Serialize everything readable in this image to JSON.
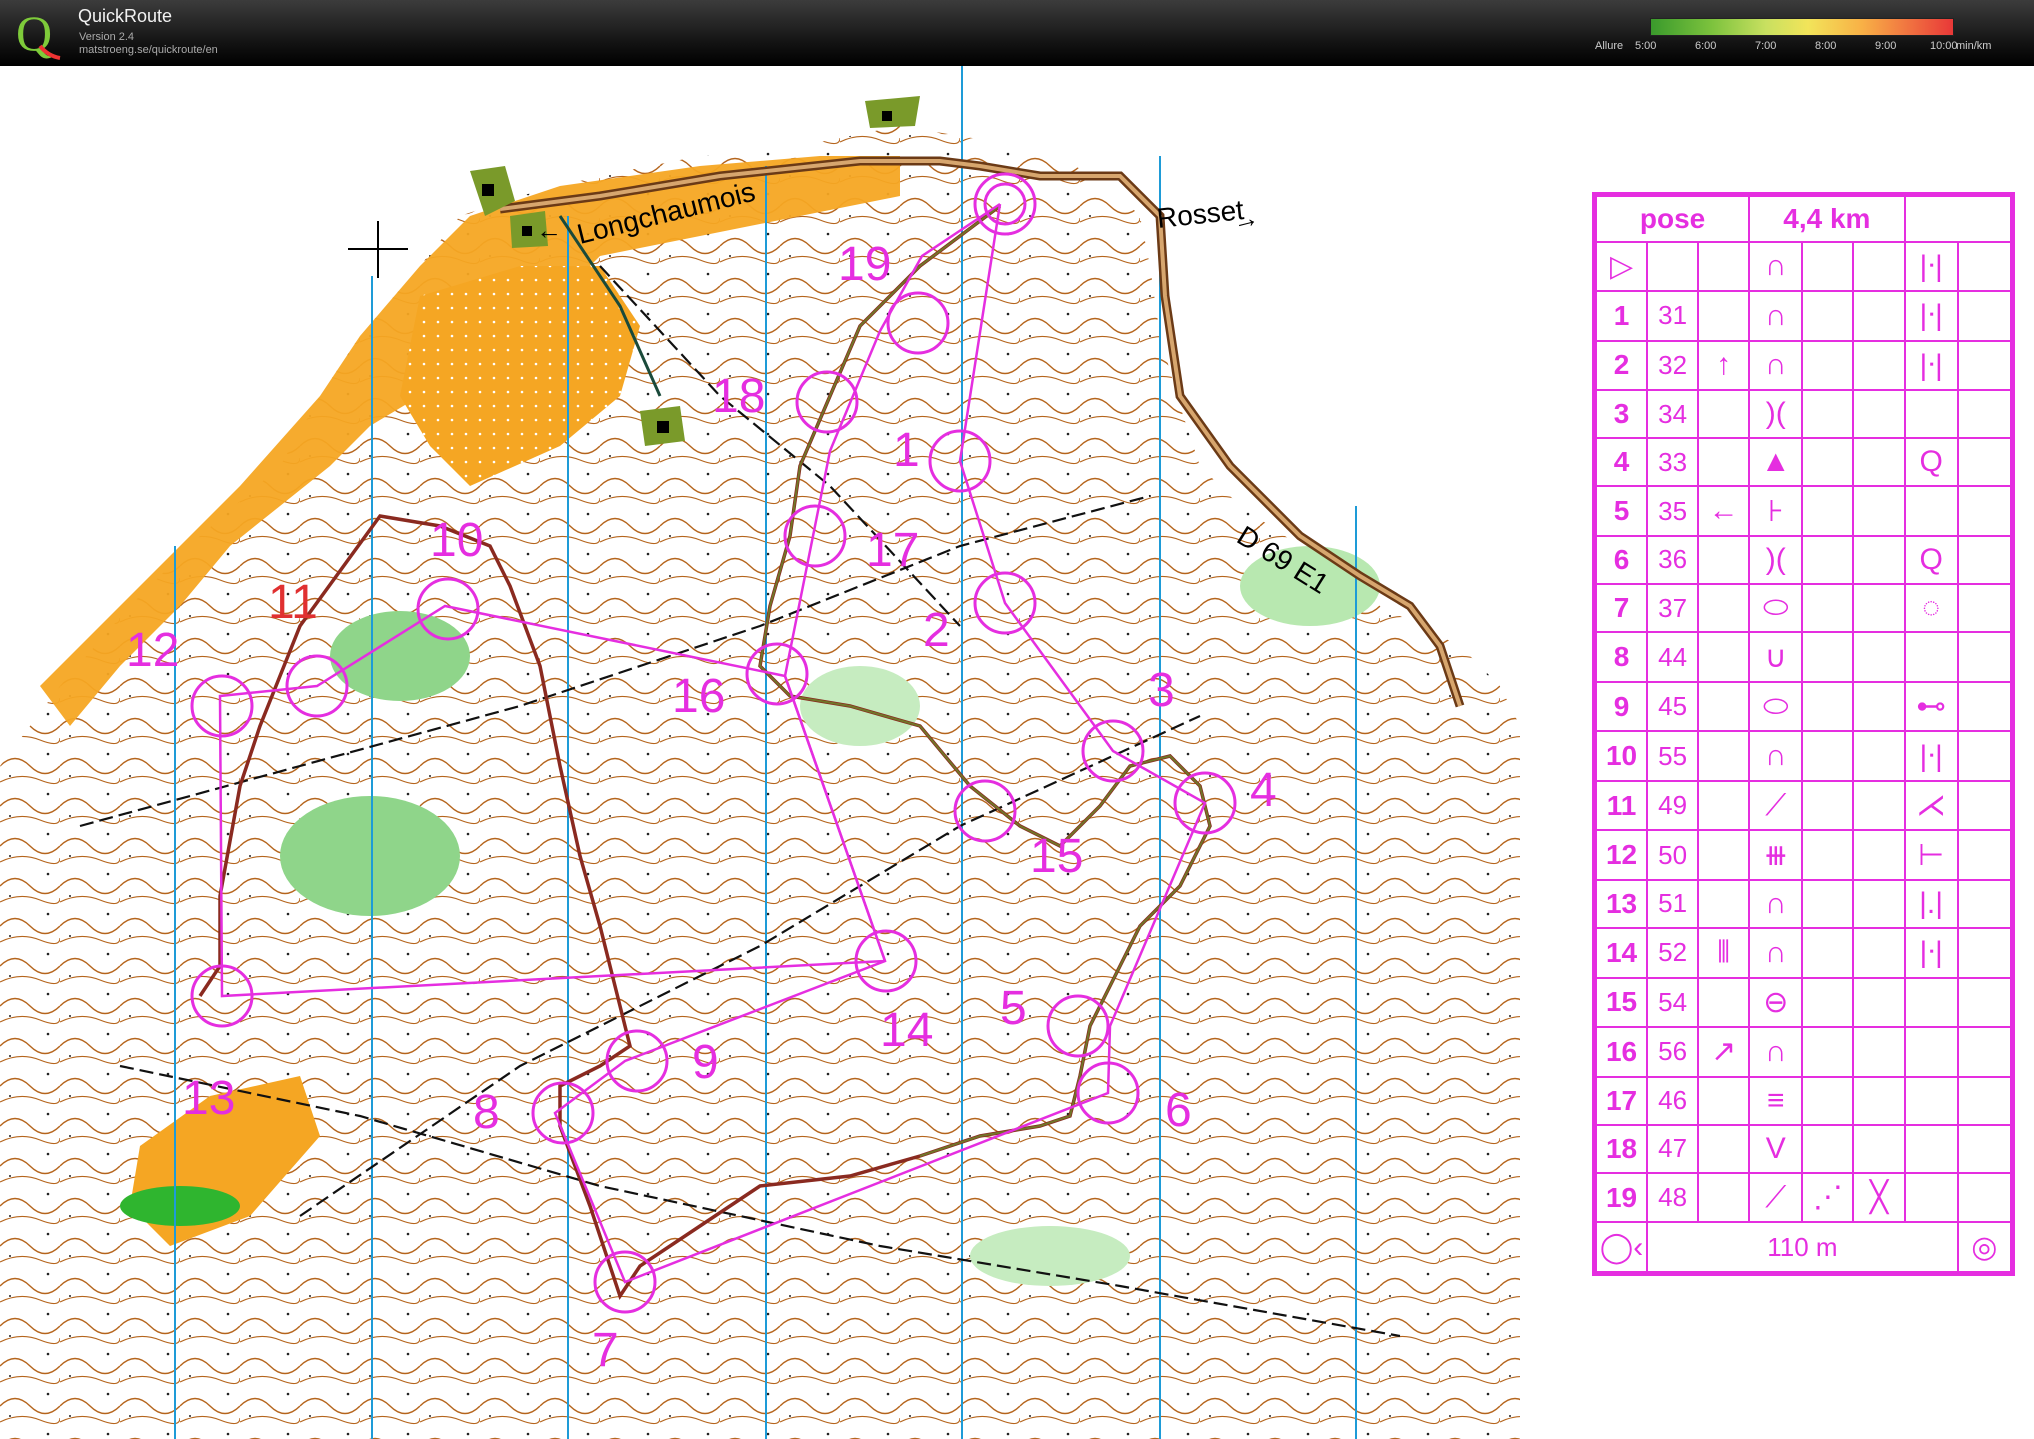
{
  "header": {
    "app_name": "QuickRoute",
    "version": "Version 2.4",
    "url": "matstroeng.se/quickroute/en",
    "logo_letter": "Q"
  },
  "pace_legend": {
    "title": "Allure",
    "ticks": [
      "5:00",
      "6:00",
      "7:00",
      "8:00",
      "9:00",
      "10:00"
    ],
    "unit": "min/km"
  },
  "map": {
    "road_labels": {
      "longchaumois": "Longchaumois",
      "rosset": "Rosset",
      "d69": "D 69 E1"
    },
    "arrows": {
      "left": "←",
      "right": "→"
    },
    "course_color": "#e52ee0",
    "route_color": "#8a2a20",
    "control_numbers": [
      "1",
      "2",
      "3",
      "4",
      "5",
      "6",
      "7",
      "8",
      "9",
      "10",
      "11",
      "12",
      "13",
      "14",
      "15",
      "16",
      "17",
      "18",
      "19"
    ]
  },
  "description_sheet": {
    "event": "pose",
    "length": "4,4 km",
    "start_symbol": "▷",
    "controls": [
      {
        "num": "1",
        "code": "31",
        "dir": "",
        "feature": "∩",
        "detail": "",
        "dim": "",
        "loc": "|ᐧ|"
      },
      {
        "num": "2",
        "code": "32",
        "dir": "↑",
        "feature": "∩",
        "detail": "",
        "dim": "",
        "loc": "|ᐧ|"
      },
      {
        "num": "3",
        "code": "34",
        "dir": "",
        "feature": ")(",
        "detail": "",
        "dim": "",
        "loc": ""
      },
      {
        "num": "4",
        "code": "33",
        "dir": "",
        "feature": "▲",
        "detail": "",
        "dim": "",
        "loc": "Q"
      },
      {
        "num": "5",
        "code": "35",
        "dir": "←",
        "feature": "⊦",
        "detail": "",
        "dim": "",
        "loc": ""
      },
      {
        "num": "6",
        "code": "36",
        "dir": "",
        "feature": ")(",
        "detail": "",
        "dim": "",
        "loc": "Q"
      },
      {
        "num": "7",
        "code": "37",
        "dir": "",
        "feature": "⬭",
        "detail": "",
        "dim": "",
        "loc": "◌"
      },
      {
        "num": "8",
        "code": "44",
        "dir": "",
        "feature": "∪",
        "detail": "",
        "dim": "",
        "loc": ""
      },
      {
        "num": "9",
        "code": "45",
        "dir": "",
        "feature": "⬭",
        "detail": "",
        "dim": "",
        "loc": "⊷"
      },
      {
        "num": "10",
        "code": "55",
        "dir": "",
        "feature": "∩",
        "detail": "",
        "dim": "",
        "loc": "|ᐧ|"
      },
      {
        "num": "11",
        "code": "49",
        "dir": "",
        "feature": "⟋",
        "detail": "",
        "dim": "",
        "loc": "⋌"
      },
      {
        "num": "12",
        "code": "50",
        "dir": "",
        "feature": "⧻",
        "detail": "",
        "dim": "",
        "loc": "⊢"
      },
      {
        "num": "13",
        "code": "51",
        "dir": "",
        "feature": "∩",
        "detail": "",
        "dim": "",
        "loc": "|.|"
      },
      {
        "num": "14",
        "code": "52",
        "dir": "⦀",
        "feature": "∩",
        "detail": "",
        "dim": "",
        "loc": "|ᐧ|"
      },
      {
        "num": "15",
        "code": "54",
        "dir": "",
        "feature": "⊖",
        "detail": "",
        "dim": "",
        "loc": ""
      },
      {
        "num": "16",
        "code": "56",
        "dir": "↗",
        "feature": "∩",
        "detail": "",
        "dim": "",
        "loc": ""
      },
      {
        "num": "17",
        "code": "46",
        "dir": "",
        "feature": "≡",
        "detail": "",
        "dim": "",
        "loc": ""
      },
      {
        "num": "18",
        "code": "47",
        "dir": "",
        "feature": "V",
        "detail": "",
        "dim": "",
        "loc": ""
      },
      {
        "num": "19",
        "code": "48",
        "dir": "",
        "feature": "⟋",
        "detail": "⋰",
        "dim": "╳",
        "loc": ""
      }
    ],
    "finish_distance": "110 m"
  }
}
